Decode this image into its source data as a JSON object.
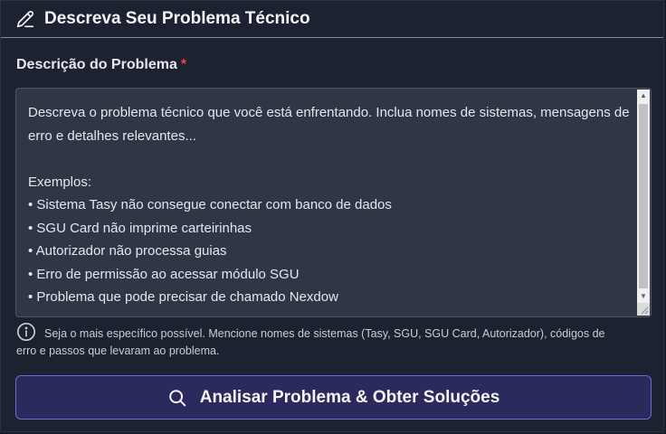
{
  "header": {
    "title": "Descreva Seu Problema Técnico",
    "icon": "pencil-icon"
  },
  "field": {
    "label": "Descrição do Problema",
    "required_mark": "*",
    "placeholder": "Descreva o problema técnico que você está enfrentando. Inclua nomes de sistemas, mensagens de erro e detalhes relevantes...\n\nExemplos:\n• Sistema Tasy não consegue conectar com banco de dados\n• SGU Card não imprime carteirinhas\n• Autorizador não processa guias\n• Erro de permissão ao acessar módulo SGU\n• Problema que pode precisar de chamado Nexdow",
    "placeholder_lines": [
      "Descreva o problema técnico que você está enfrentando. Inclua nomes de sistemas,",
      "mensagens de erro e detalhes relevantes...",
      "",
      "Exemplos:",
      "• Sistema Tasy não consegue conectar com banco de dados",
      "• SGU Card não imprime carteirinhas",
      "• Autorizador não processa guias",
      "• Erro de permissão ao acessar módulo SGU",
      "• Problema que pode precisar de chamado Nexdow"
    ]
  },
  "hint": {
    "icon": "info-icon",
    "line1": "Seja o mais específico possível. Mencione nomes de sistemas (Tasy, SGU, SGU Card, Autorizador), códigos de",
    "line2": "erro e passos que levaram ao problema."
  },
  "submit": {
    "label": "Analisar Problema & Obter Soluções",
    "icon": "search-icon"
  },
  "colors": {
    "background": "#1c2230",
    "accent": "#6e6bd6",
    "button_bg": "#2a2a5c",
    "required": "#ef4444"
  }
}
